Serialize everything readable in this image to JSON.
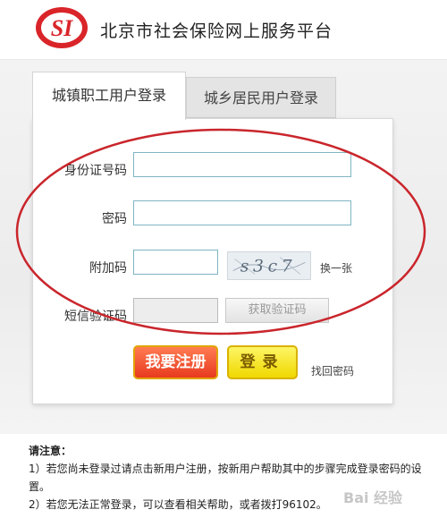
{
  "header": {
    "site_title": "北京市社会保险网上服务平台",
    "logo_text": "SI"
  },
  "tabs": [
    {
      "label": "城镇职工用户登录",
      "active": true
    },
    {
      "label": "城乡居民用户登录",
      "active": false
    }
  ],
  "form": {
    "id_label": "身份证号码",
    "id_value": "",
    "password_label": "密码",
    "password_value": "",
    "captcha_label": "附加码",
    "captcha_value": "",
    "captcha_text": "s3c7",
    "refresh_captcha": "换一张",
    "sms_label": "短信验证码",
    "sms_value": "",
    "get_sms_button": "获取验证码",
    "register_button": "我要注册",
    "login_button": "登录",
    "forgot_password": "找回密码"
  },
  "notice": {
    "title": "请注意：",
    "lines": [
      "1）若您尚未登录过请点击新用户注册，按新用户帮助其中的步骤完成登录密码的设置。",
      "2）若您无法正常登录，可以查看相关帮助，或者拨打96102。"
    ]
  },
  "watermark": {
    "text": "Bai 经验"
  },
  "colors": {
    "annotation_circle": "#c9262c",
    "logo_red": "#d9252a",
    "register": "#e8391f",
    "login": "#f0d800"
  }
}
